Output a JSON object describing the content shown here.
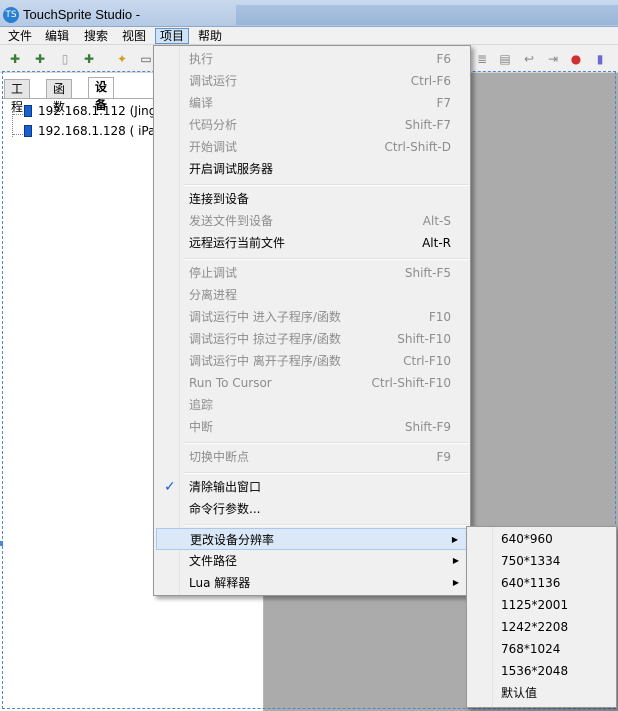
{
  "window": {
    "title": "TouchSprite Studio -",
    "icon_text": "TS"
  },
  "menubar": [
    "文件",
    "编辑",
    "搜索",
    "视图",
    "项目",
    "帮助"
  ],
  "left_panel": {
    "tabs": [
      "工程",
      "函数",
      "设备"
    ],
    "selected_tab": "设备",
    "devices": [
      "192.168.1.112 (Jing",
      "192.168.1.128 ( iPac"
    ]
  },
  "project_menu": {
    "items": [
      {
        "label": "执行",
        "shortcut": "F6",
        "enabled": false
      },
      {
        "label": "调试运行",
        "shortcut": "Ctrl-F6",
        "enabled": false
      },
      {
        "label": "编译",
        "shortcut": "F7",
        "enabled": false
      },
      {
        "label": "代码分析",
        "shortcut": "Shift-F7",
        "enabled": false
      },
      {
        "label": "开始调试",
        "shortcut": "Ctrl-Shift-D",
        "enabled": false
      },
      {
        "label": "开启调试服务器",
        "shortcut": "",
        "enabled": true
      },
      {
        "label": "连接到设备",
        "shortcut": "",
        "enabled": true
      },
      {
        "label": "发送文件到设备",
        "shortcut": "Alt-S",
        "enabled": false
      },
      {
        "label": "远程运行当前文件",
        "shortcut": "Alt-R",
        "enabled": true
      },
      {
        "label": "停止调试",
        "shortcut": "Shift-F5",
        "enabled": false
      },
      {
        "label": "分离进程",
        "shortcut": "",
        "enabled": false
      },
      {
        "label": "调试运行中 进入子程序/函数",
        "shortcut": "F10",
        "enabled": false
      },
      {
        "label": "调试运行中 掠过子程序/函数",
        "shortcut": "Shift-F10",
        "enabled": false
      },
      {
        "label": "调试运行中 离开子程序/函数",
        "shortcut": "Ctrl-F10",
        "enabled": false
      },
      {
        "label": "Run To Cursor",
        "shortcut": "Ctrl-Shift-F10",
        "enabled": false
      },
      {
        "label": "追踪",
        "shortcut": "",
        "enabled": false
      },
      {
        "label": "中断",
        "shortcut": "Shift-F9",
        "enabled": false
      },
      {
        "label": "切换中断点",
        "shortcut": "F9",
        "enabled": false
      },
      {
        "label": "清除输出窗口",
        "shortcut": "",
        "enabled": true,
        "checked": true
      },
      {
        "label": "命令行参数...",
        "shortcut": "",
        "enabled": true
      },
      {
        "label": "更改设备分辨率",
        "shortcut": "",
        "enabled": true,
        "submenu": true,
        "highlighted": true
      },
      {
        "label": "文件路径",
        "shortcut": "",
        "enabled": true,
        "submenu": true
      },
      {
        "label": "Lua 解释器",
        "shortcut": "",
        "enabled": true,
        "submenu": true
      }
    ]
  },
  "resolution_submenu": [
    "640*960",
    "750*1334",
    "640*1136",
    "1125*2001",
    "1242*2208",
    "768*1024",
    "1536*2048",
    "默认值"
  ],
  "colors": {
    "disabled_text": "#8d8d8d",
    "highlight": "#dbe8f7",
    "device_icon": "#1a5fd0"
  }
}
